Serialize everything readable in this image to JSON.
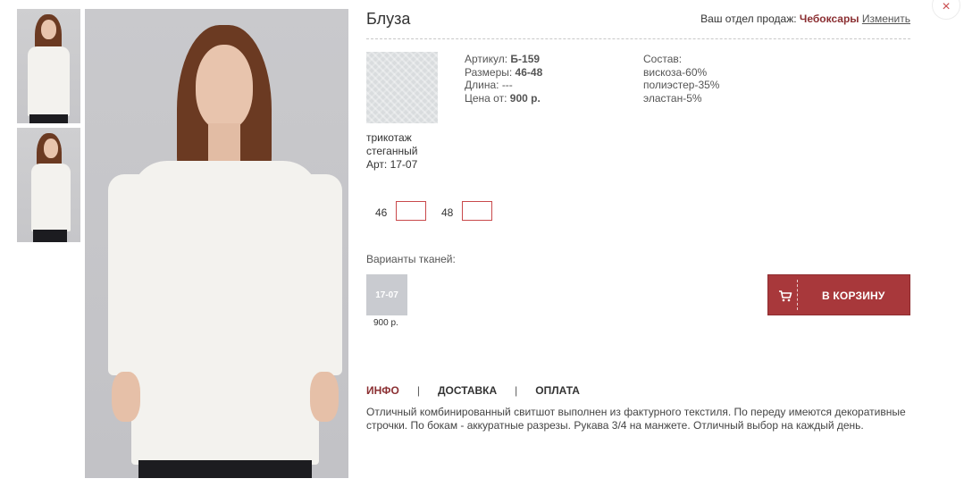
{
  "close": {
    "label": "×"
  },
  "product": {
    "title": "Блуза",
    "article_label": "Артикул:",
    "article_value": "Б-159",
    "sizes_label": "Размеры:",
    "sizes_value": "46-48",
    "length_label": "Длина:",
    "length_value": "---",
    "price_label": "Цена от:",
    "price_value": "900 р."
  },
  "region": {
    "label": "Ваш отдел продаж:",
    "city": "Чебоксары",
    "change_link": "Изменить"
  },
  "fabric": {
    "name_line1": "трикотаж",
    "name_line2": "стеганный",
    "art": "Арт: 17-07"
  },
  "composition": {
    "label": "Состав:",
    "items": [
      "вискоза-60%",
      "полиэстер-35%",
      "эластан-5%"
    ]
  },
  "sizes": [
    {
      "label": "46",
      "qty": ""
    },
    {
      "label": "48",
      "qty": ""
    }
  ],
  "variants": {
    "label": "Варианты тканей:",
    "items": [
      {
        "code": "17-07",
        "price": "900 р.",
        "color": "#c9cbd0"
      }
    ]
  },
  "cart": {
    "label": "В КОРЗИНУ",
    "icon": "cart-icon",
    "color": "#a8383b"
  },
  "tabs": [
    {
      "label": "ИНФО",
      "active": true
    },
    {
      "label": "ДОСТАВКА",
      "active": false
    },
    {
      "label": "ОПЛАТА",
      "active": false
    }
  ],
  "tab_separator": "|",
  "description": "Отличный комбинированный свитшот выполнен из фактурного текстиля. По переду имеются декоративные строчки. По бокам - аккуратные разрезы. Рукава 3/4 на манжете. Отличный выбор на каждый день."
}
